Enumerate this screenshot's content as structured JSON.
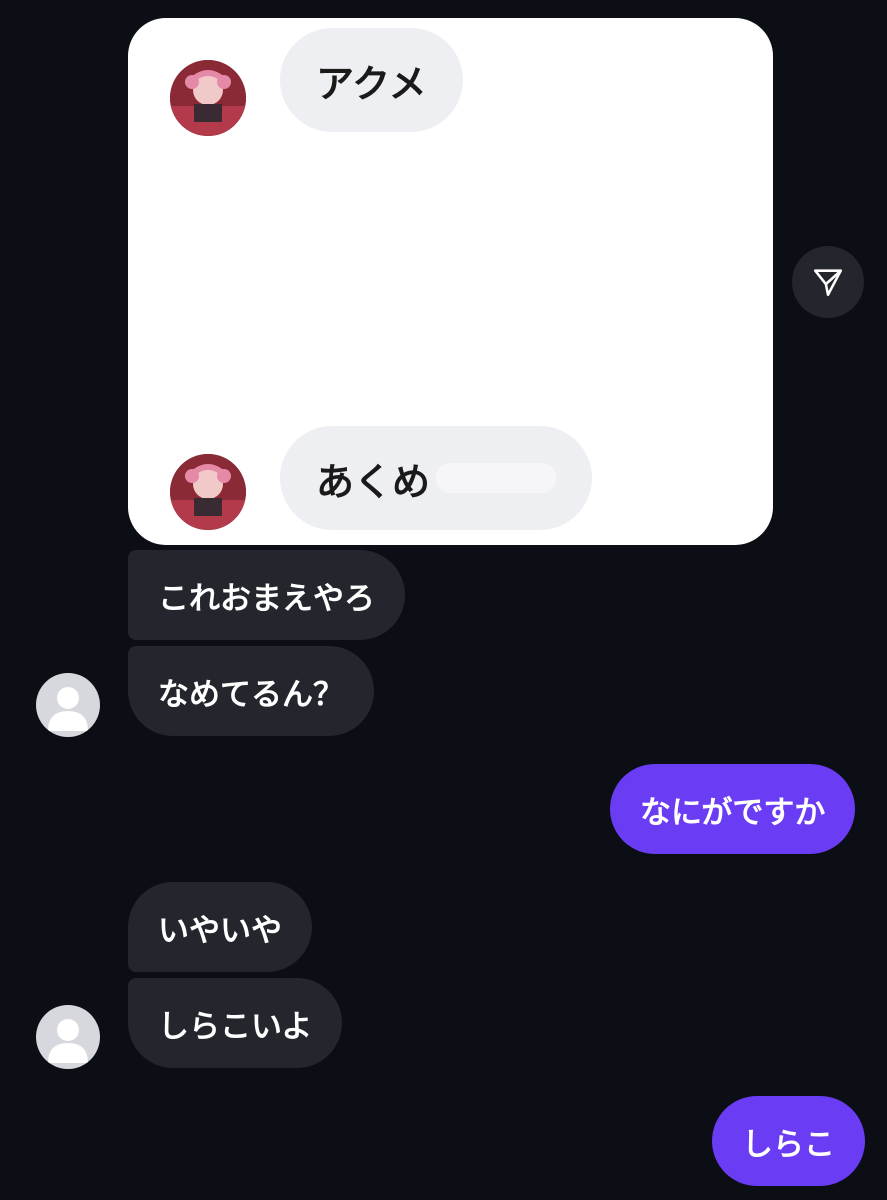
{
  "shared_post": {
    "top_message": "アクメ",
    "bottom_message_visible": "あくめ"
  },
  "messages": [
    {
      "from": "them",
      "text": "これおまえやろ"
    },
    {
      "from": "them",
      "text": "なめてるん？"
    },
    {
      "from": "me",
      "text": "なにがですか"
    },
    {
      "from": "them",
      "text": "いやいや"
    },
    {
      "from": "them",
      "text": "しらこいよ"
    },
    {
      "from": "me",
      "text": "しらこ"
    }
  ],
  "colors": {
    "background": "#0b0e14",
    "incoming_bubble": "#23262d",
    "outgoing_bubble": "#6a3df5"
  },
  "icons": {
    "share": "send-icon",
    "avatar": "default-avatar-icon"
  }
}
